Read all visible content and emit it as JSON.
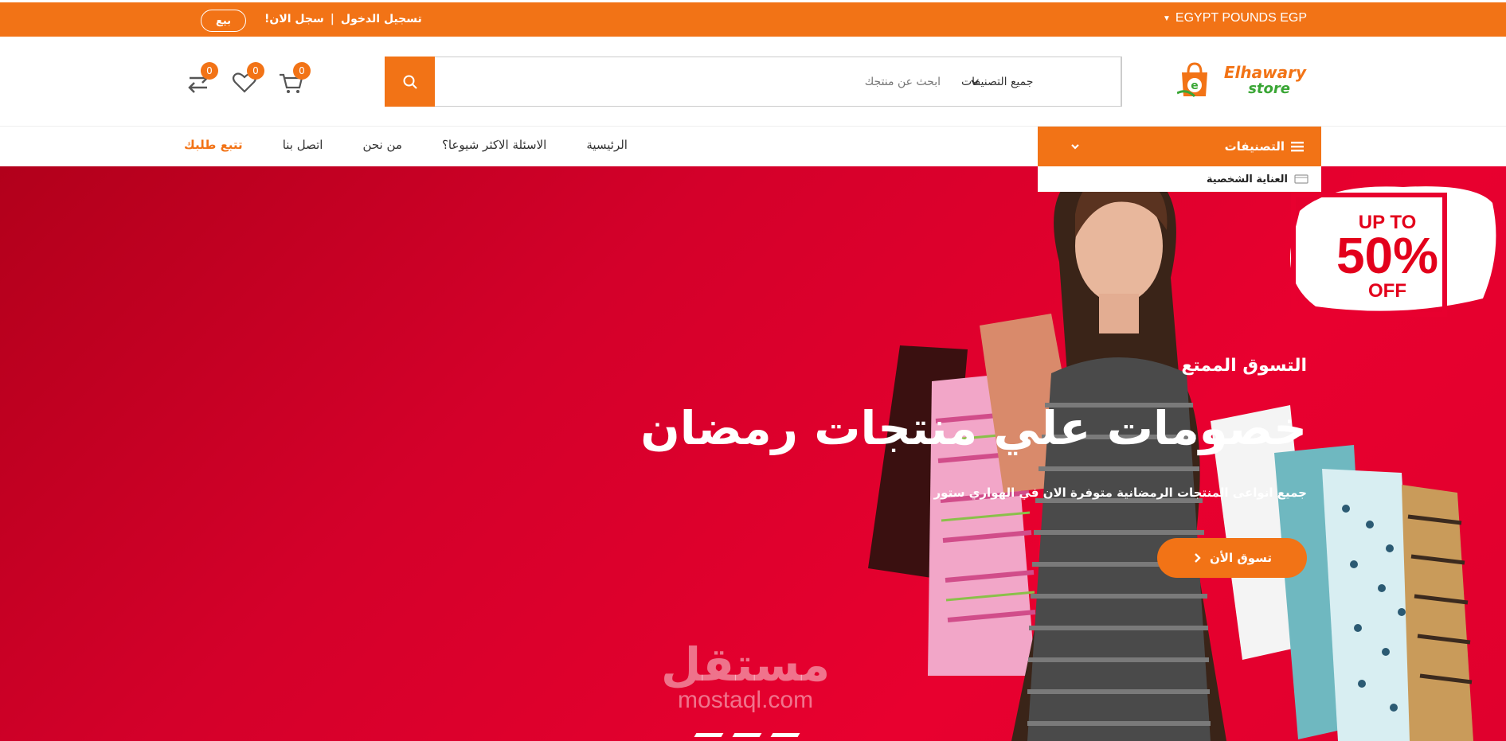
{
  "topbar": {
    "currency": "EGYPT POUNDS EGP",
    "login": "تسجيل الدخول",
    "separator": "|",
    "register": "سجل الان!",
    "sell": "بيع"
  },
  "header": {
    "logo_line1": "Elhawary",
    "logo_line2": "store",
    "search_placeholder": "ابحث عن منتجك",
    "category_select": "جميع التصنيفات",
    "cart_count": "0",
    "wishlist_count": "0",
    "compare_count": "0"
  },
  "nav": {
    "categories_label": "التصنيفات",
    "items": [
      {
        "label": "الرئيسية"
      },
      {
        "label": "الاسئلة الاكثر شيوعا؟"
      },
      {
        "label": "من نحن"
      },
      {
        "label": "اتصل بنا"
      },
      {
        "label": "تتبع طلبك"
      }
    ],
    "dropdown_first": "العناية الشخصية"
  },
  "hero": {
    "kicker": "التسوق الممتع",
    "headline": "خصومات علي منتجات رمضان",
    "subline": "جميع انواعى المنتجات الرمضانية متوفرة الان في الهواري ستور",
    "cta": "تسوق الأن",
    "promo_line1": "UP TO",
    "promo_line2": "50%",
    "promo_line3": "OFF",
    "watermark_ar": "مستقل",
    "watermark_en": "mostaql.com"
  },
  "colors": {
    "accent": "#f27316",
    "hero_red": "#e0002d",
    "logo_green": "#3aa635"
  }
}
